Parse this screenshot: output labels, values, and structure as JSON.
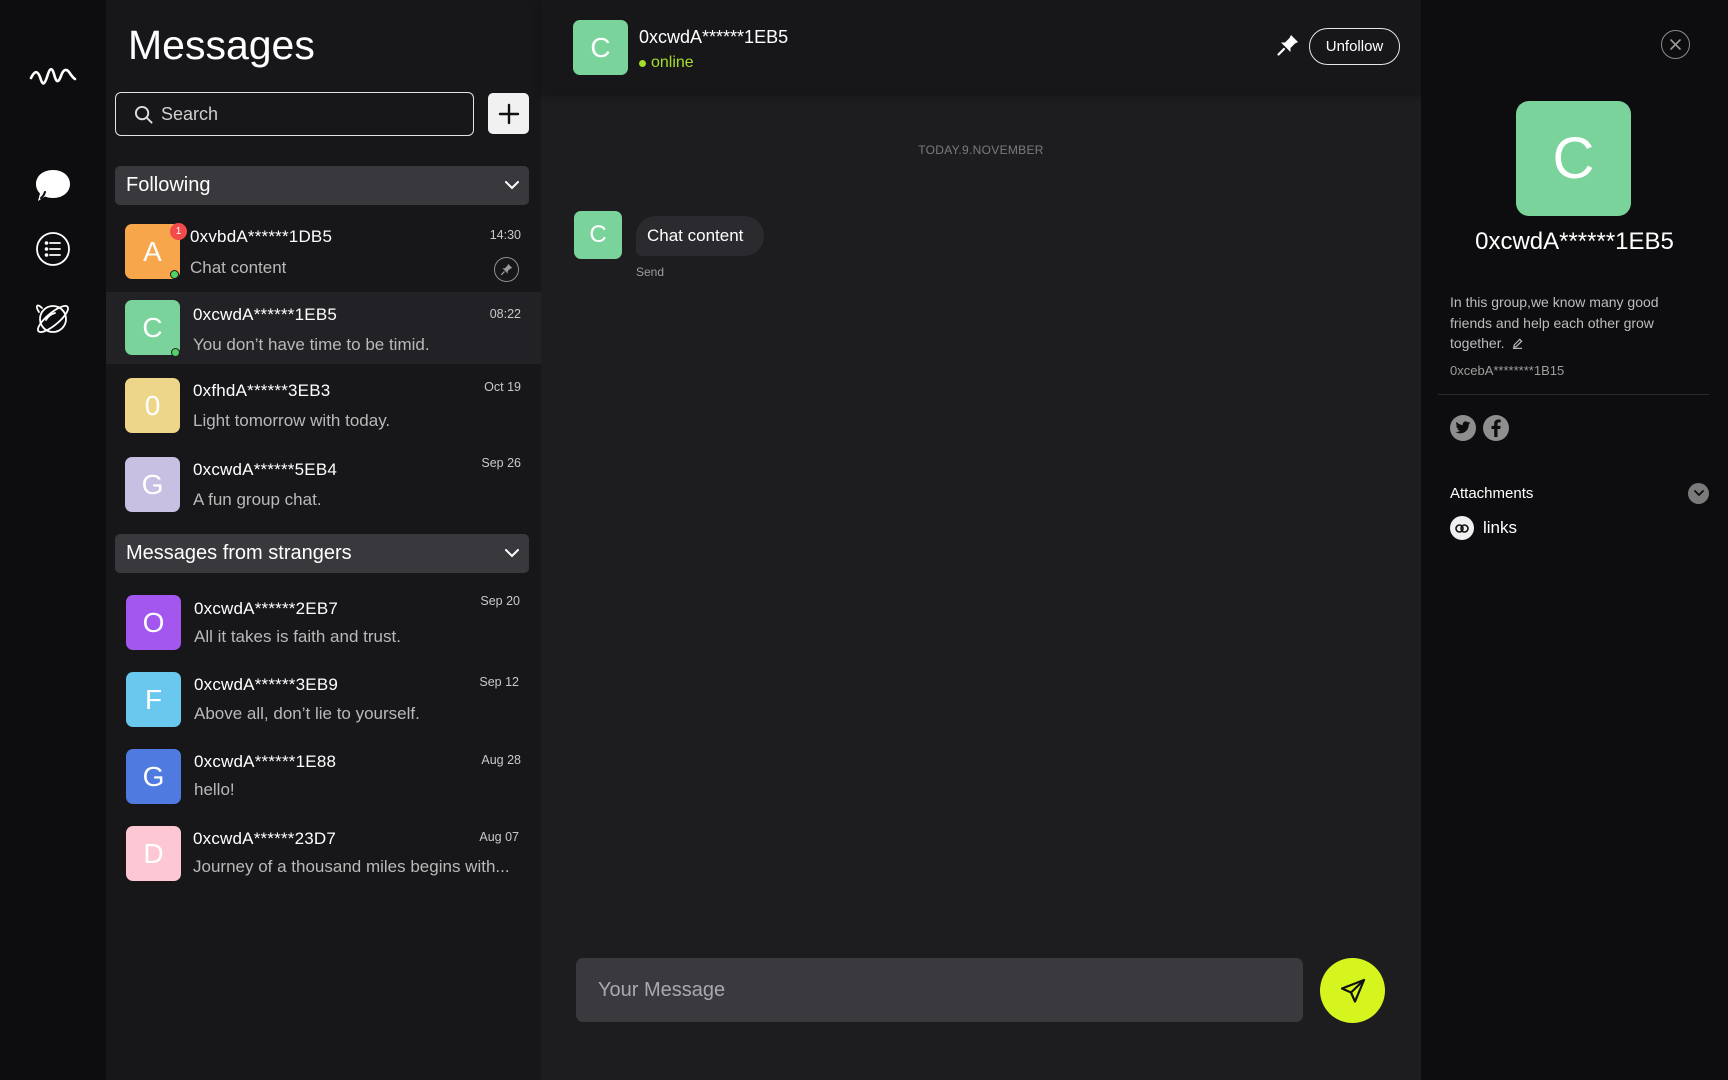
{
  "colors": {
    "accent": "#d6f51f",
    "online": "#a4dd2b",
    "badge": "#f34b4b"
  },
  "rail": {
    "icons": [
      "brand-logo-icon",
      "chat-bubble-icon",
      "list-icon",
      "planet-icon"
    ]
  },
  "list": {
    "title": "Messages",
    "search_placeholder": "Search",
    "sections": [
      {
        "label": "Following",
        "items": [
          {
            "initial": "A",
            "name": "0xvbdA******1DB5",
            "preview": "Chat content",
            "time": "14:30",
            "color": "#f8a64b",
            "badge": "1",
            "online": true,
            "pinned": true
          },
          {
            "initial": "C",
            "name": "0xcwdA******1EB5",
            "preview": "You don’t have time to be timid.",
            "time": "08:22",
            "color": "#7ad39a",
            "online": true,
            "active": true
          },
          {
            "initial": "0",
            "name": "0xfhdA******3EB3",
            "preview": "Light tomorrow with today.",
            "time": "Oct 19",
            "color": "#edd68a"
          },
          {
            "initial": "G",
            "name": "0xcwdA******5EB4",
            "preview": "A fun group chat.",
            "time": "Sep 26",
            "color": "#c8c0e2"
          }
        ]
      },
      {
        "label": "Messages from strangers",
        "items": [
          {
            "initial": "O",
            "name": "0xcwdA******2EB7",
            "preview": "All it takes is faith and trust.",
            "time": "Sep 20",
            "color": "#a457ee"
          },
          {
            "initial": "F",
            "name": "0xcwdA******3EB9",
            "preview": "Above all, don’t lie to yourself.",
            "time": "Sep 12",
            "color": "#6ac8ee"
          },
          {
            "initial": "G",
            "name": "0xcwdA******1E88",
            "preview": "hello!",
            "time": "Aug 28",
            "color": "#4f7be0"
          },
          {
            "initial": "D",
            "name": "0xcwdA******23D7",
            "preview": "Journey of a thousand miles begins with...",
            "time": "Aug 07",
            "color": "#fdc8d4"
          }
        ]
      }
    ]
  },
  "chat": {
    "contact_initial": "C",
    "contact_name": "0xcwdA******1EB5",
    "contact_color": "#7ad39a",
    "status": "online",
    "unfollow_label": "Unfollow",
    "date_separator": "TODAY.9.NOVEMBER",
    "messages": [
      {
        "initial": "C",
        "text": "Chat content",
        "status": "Send"
      }
    ],
    "composer_placeholder": "Your Message"
  },
  "profile": {
    "initial": "C",
    "name": "0xcwdA******1EB5",
    "bio": "In this group,we know many good friends and help each other grow together.",
    "address": "0xcebA********1B15",
    "attachments_label": "Attachments",
    "links_label": "links"
  }
}
